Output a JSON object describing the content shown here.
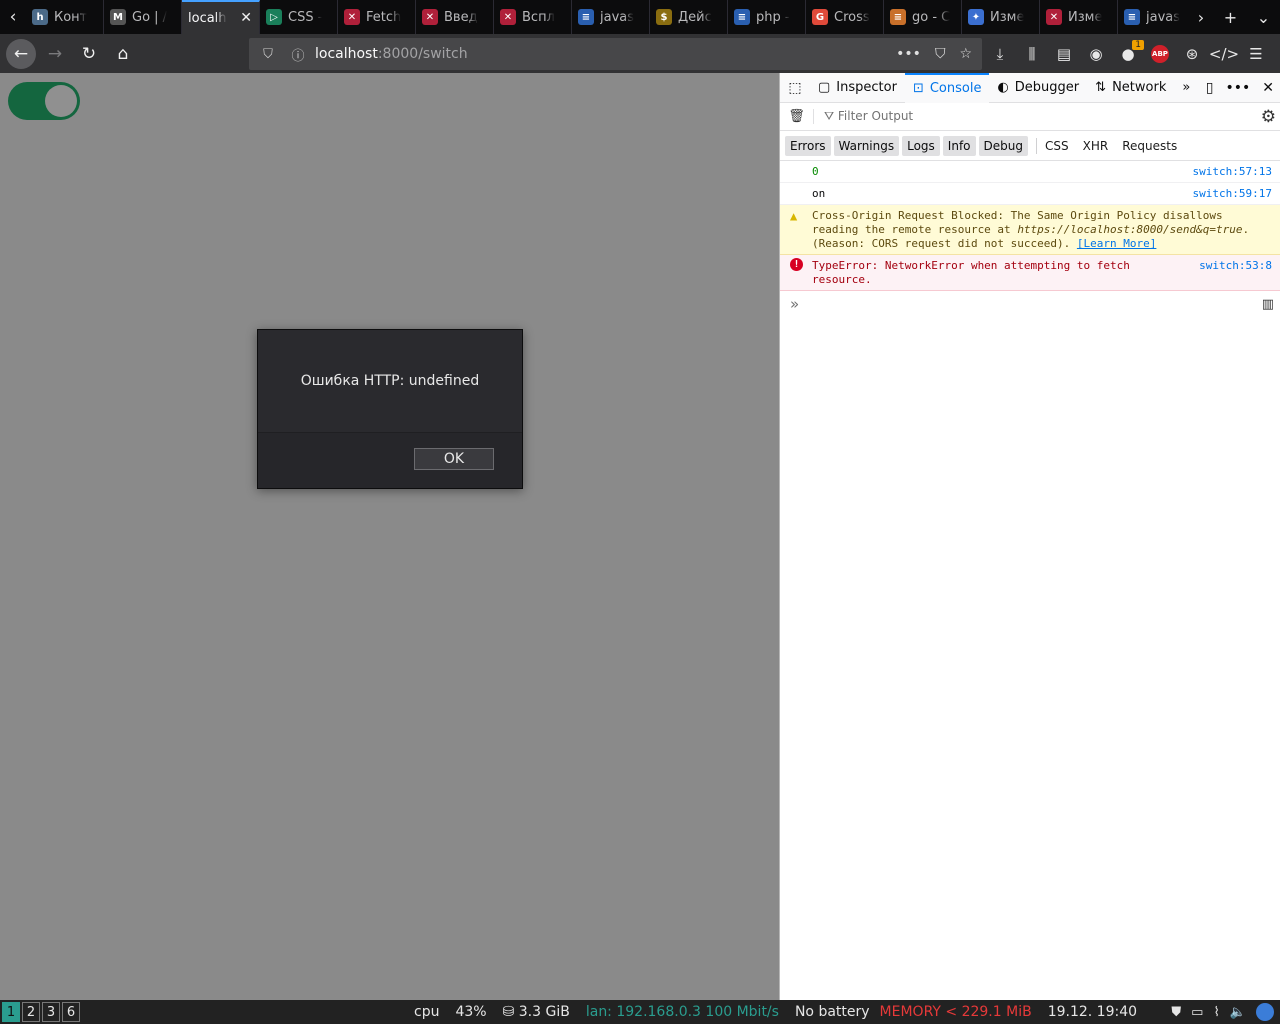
{
  "tabs": [
    {
      "label": "Конт",
      "icon": "h",
      "color": "#4b6a88",
      "active": false
    },
    {
      "label": "Go | /",
      "icon": "M",
      "color": "#555",
      "active": false
    },
    {
      "label": "localh",
      "icon": "",
      "color": "",
      "active": true
    },
    {
      "label": "CSS -",
      "icon": "▷",
      "color": "#1a7f5a",
      "active": false
    },
    {
      "label": "Fetch",
      "icon": "✕",
      "color": "#b0203a",
      "active": false
    },
    {
      "label": "Введ",
      "icon": "✕",
      "color": "#b0203a",
      "active": false
    },
    {
      "label": "Вспл",
      "icon": "✕",
      "color": "#b0203a",
      "active": false
    },
    {
      "label": "javas",
      "icon": "≡",
      "color": "#2a5fb0",
      "active": false
    },
    {
      "label": "Дейс",
      "icon": "$",
      "color": "#8a6d10",
      "active": false
    },
    {
      "label": "php -",
      "icon": "≡",
      "color": "#2a5fb0",
      "active": false
    },
    {
      "label": "Cross",
      "icon": "G",
      "color": "#e04a3a",
      "active": false
    },
    {
      "label": "go - С",
      "icon": "≡",
      "color": "#c8702a",
      "active": false
    },
    {
      "label": "Изме",
      "icon": "✦",
      "color": "#3b6fd0",
      "active": false
    },
    {
      "label": "Изме",
      "icon": "✕",
      "color": "#b0203a",
      "active": false
    },
    {
      "label": "javas",
      "icon": "≡",
      "color": "#2a5fb0",
      "active": false
    }
  ],
  "url": {
    "host": "localhost",
    "path": ":8000/switch"
  },
  "toolbar": {
    "notification_count": "1",
    "abp_label": "ABP"
  },
  "dialog": {
    "message": "Ошибка HTTP: undefined",
    "ok_label": "OK"
  },
  "devtools": {
    "tabs": {
      "inspector": "Inspector",
      "console": "Console",
      "debugger": "Debugger",
      "network": "Network"
    },
    "filter_placeholder": "Filter Output",
    "levels": [
      "Errors",
      "Warnings",
      "Logs",
      "Info",
      "Debug"
    ],
    "types": [
      "CSS",
      "XHR",
      "Requests"
    ],
    "messages": {
      "m0": {
        "text": "0",
        "source": "switch:57:13"
      },
      "m1": {
        "text": "on",
        "source": "switch:59:17"
      },
      "warn": {
        "text_before": "Cross-Origin Request Blocked: The Same Origin Policy disallows reading the remote resource at ",
        "url": "https://localhost:8000/send&q=true",
        "text_after": ". (Reason: CORS request did not succeed). ",
        "learn_more": "[Learn More]"
      },
      "error": {
        "text": "TypeError: NetworkError when attempting to fetch resource.",
        "source": "switch:53:8"
      }
    }
  },
  "statusbar": {
    "workspaces": [
      "1",
      "2",
      "3",
      "6"
    ],
    "cpu_label": "cpu",
    "cpu_value": "43%",
    "disk": "⛁ 3.3 GiB",
    "lan": "lan: 192.168.0.3 100 Mbit/s",
    "battery": "No battery",
    "memory": "MEMORY < 229.1 MiB",
    "datetime": "19.12. 19:40"
  },
  "colors": {
    "toggle_on": "#14663f",
    "accent": "#0a84ff",
    "error": "#a4000f",
    "warning": "#5d4a0f"
  }
}
